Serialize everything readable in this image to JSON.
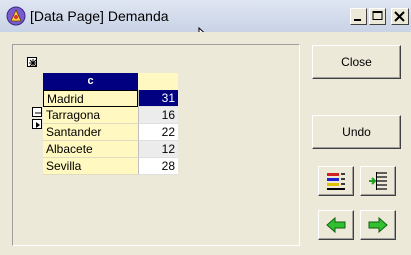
{
  "window": {
    "title": "[Data Page] Demanda"
  },
  "icons": {
    "app": "app-icon",
    "minimize": "minimize-icon",
    "maximize": "maximize-icon",
    "close": "close-icon",
    "expand": "expand-icon",
    "collapse": "collapse-icon",
    "row_pointer": "row-pointer-icon"
  },
  "table": {
    "column_header": "c",
    "rows": [
      {
        "name": "Madrid",
        "value": "31"
      },
      {
        "name": "Tarragona",
        "value": "16"
      },
      {
        "name": "Santander",
        "value": "22"
      },
      {
        "name": "Albacete",
        "value": "12"
      },
      {
        "name": "Sevilla",
        "value": "28"
      }
    ]
  },
  "buttons": {
    "close_label": "Close",
    "undo_label": "Undo"
  }
}
